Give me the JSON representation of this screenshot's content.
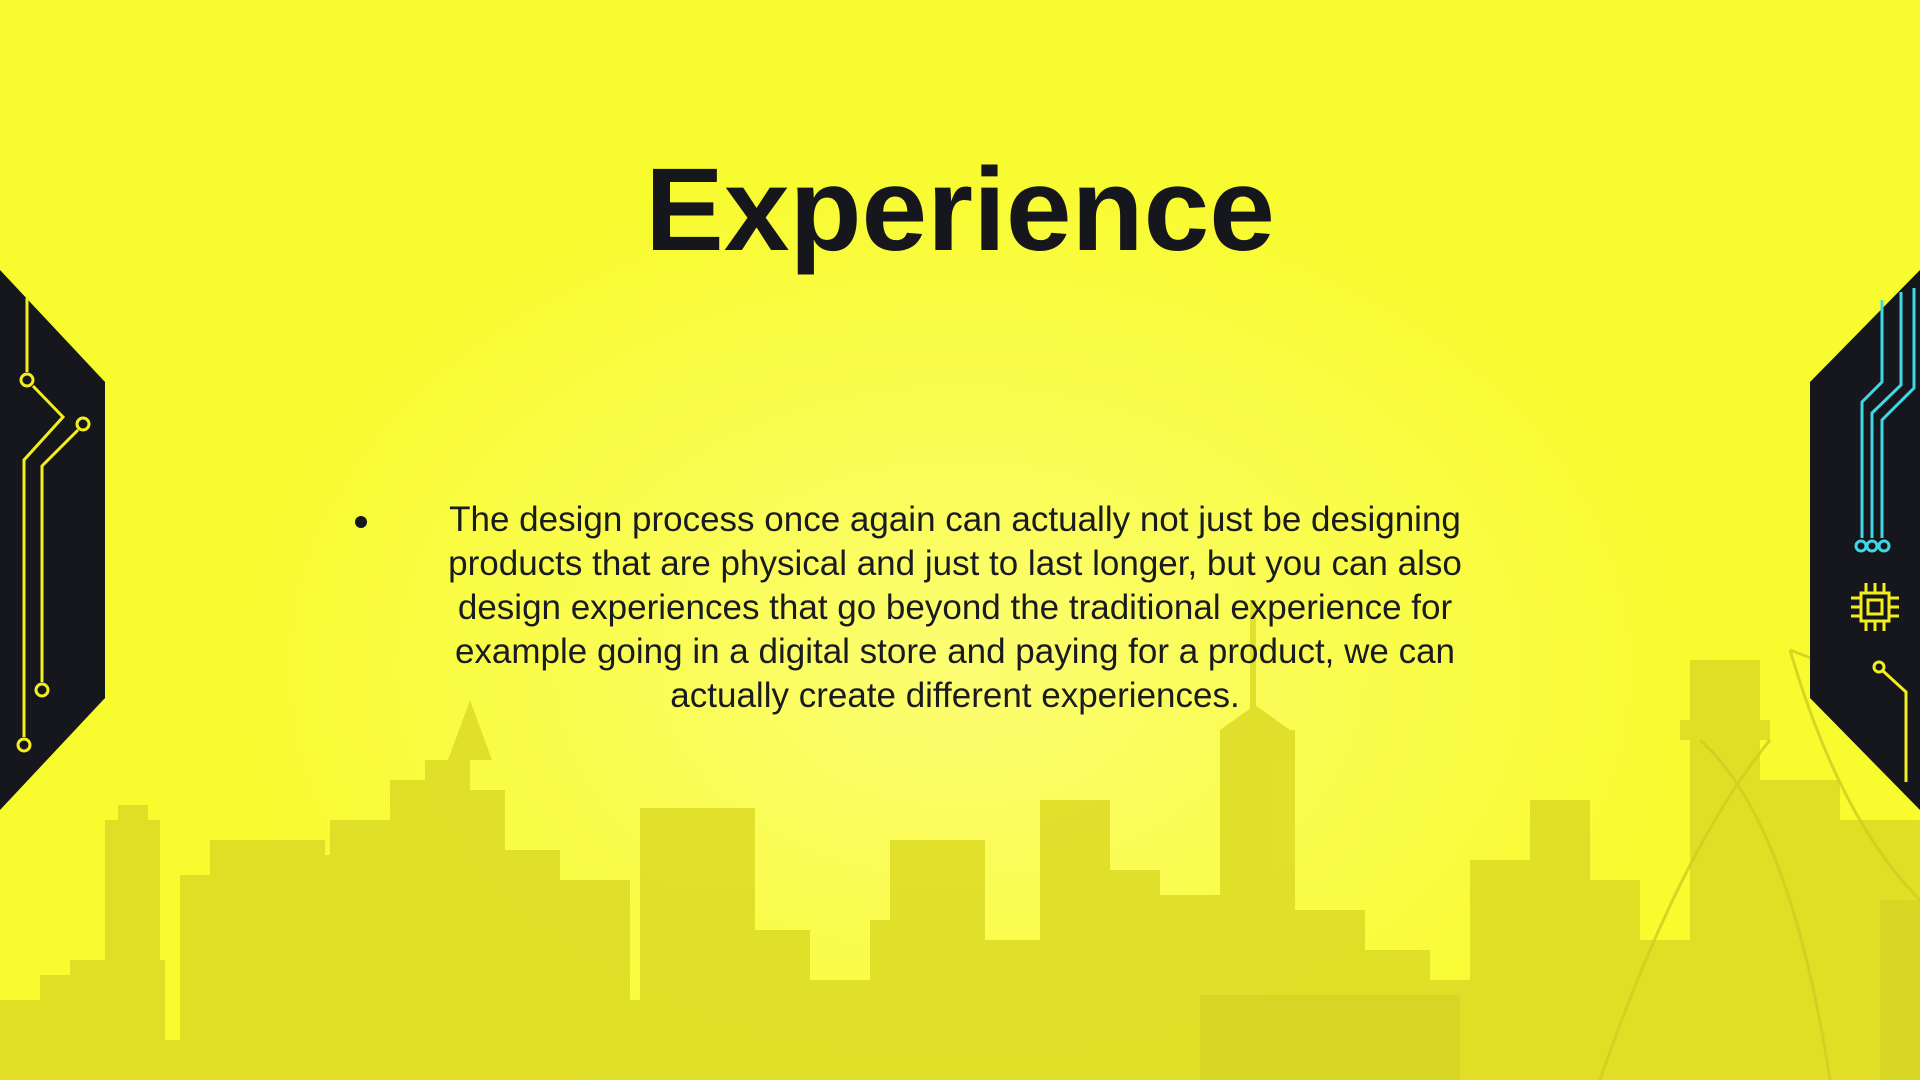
{
  "slide": {
    "title": "Experience",
    "bullets": [
      "The design process once again can actually not just be designing products that are physical and just to last longer, but you can also design experiences that go beyond the traditional experience for example going in a digital store and paying for a product, we can actually create different experiences."
    ]
  },
  "colors": {
    "background": "#f8fb2e",
    "text": "#15171d",
    "panel": "#15171d",
    "circuit_yellow": "#f3ef1f",
    "circuit_cyan": "#3fd6e6",
    "skyline": "#d9d824"
  },
  "icons": [
    "left-circuit-panel-icon",
    "right-circuit-panel-icon",
    "chip-icon",
    "city-skyline-icon"
  ]
}
